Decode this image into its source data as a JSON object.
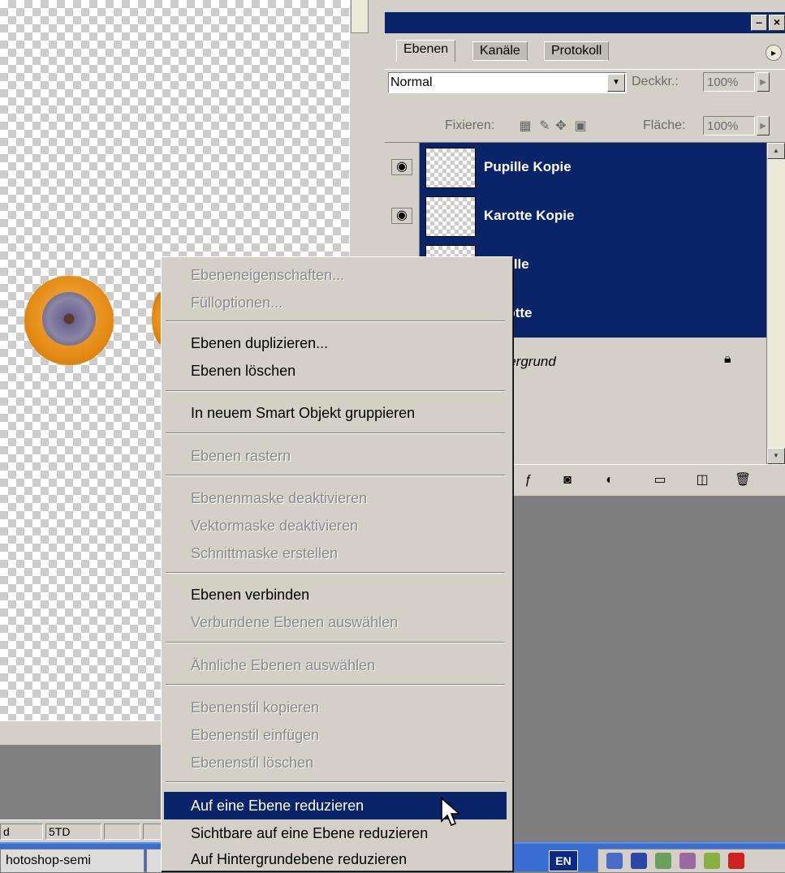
{
  "layers_panel": {
    "tabs": [
      {
        "label": "Ebenen",
        "active": true
      },
      {
        "label": "Kanäle",
        "active": false
      },
      {
        "label": "Protokoll",
        "active": false
      }
    ],
    "blend_mode": "Normal",
    "opacity_label": "Deckkr.:",
    "opacity_value": "100%",
    "lock_label": "Fixieren:",
    "fill_label": "Fläche:",
    "fill_value": "100%",
    "layers": [
      {
        "name": "Pupille Kopie",
        "visible": true,
        "selected": true
      },
      {
        "name": "Karotte Kopie",
        "visible": true,
        "selected": true
      },
      {
        "name": "Pupille",
        "visible": true,
        "selected": true
      },
      {
        "name": "Karotte",
        "visible": true,
        "selected": true
      },
      {
        "name": "Hintergrund",
        "visible": false,
        "selected": false,
        "locked": true
      }
    ]
  },
  "context_menu": {
    "items": [
      {
        "label": "Ebeneneigenschaften...",
        "enabled": false
      },
      {
        "label": "Fülloptionen...",
        "enabled": false
      },
      {
        "label": "Ebenen duplizieren...",
        "enabled": true
      },
      {
        "label": "Ebenen löschen",
        "enabled": true
      },
      {
        "label": "In neuem Smart Objekt gruppieren",
        "enabled": true
      },
      {
        "label": "Ebenen rastern",
        "enabled": false
      },
      {
        "label": "Ebenenmaske deaktivieren",
        "enabled": false
      },
      {
        "label": "Vektormaske deaktivieren",
        "enabled": false
      },
      {
        "label": "Schnittmaske erstellen",
        "enabled": false
      },
      {
        "label": "Ebenen verbinden",
        "enabled": true
      },
      {
        "label": "Verbundene Ebenen auswählen",
        "enabled": false
      },
      {
        "label": "Ähnliche Ebenen auswählen",
        "enabled": false
      },
      {
        "label": "Ebenenstil kopieren",
        "enabled": false
      },
      {
        "label": "Ebenenstil einfügen",
        "enabled": false
      },
      {
        "label": "Ebenenstil löschen",
        "enabled": false
      },
      {
        "label": "Auf eine Ebene reduzieren",
        "enabled": true,
        "highlighted": true
      },
      {
        "label": "Sichtbare auf eine Ebene reduzieren",
        "enabled": true
      },
      {
        "label": "Auf Hintergrundebene reduzieren",
        "enabled": true
      }
    ]
  },
  "statusbar": {
    "seg1": "d",
    "seg2": "5TD"
  },
  "taskbar": {
    "task_label": "hotoshop-semi",
    "language": "EN"
  },
  "colors": {
    "selection": "#0a246a",
    "panel": "#d4d0c8",
    "taskbar": "#3a6fd1"
  }
}
